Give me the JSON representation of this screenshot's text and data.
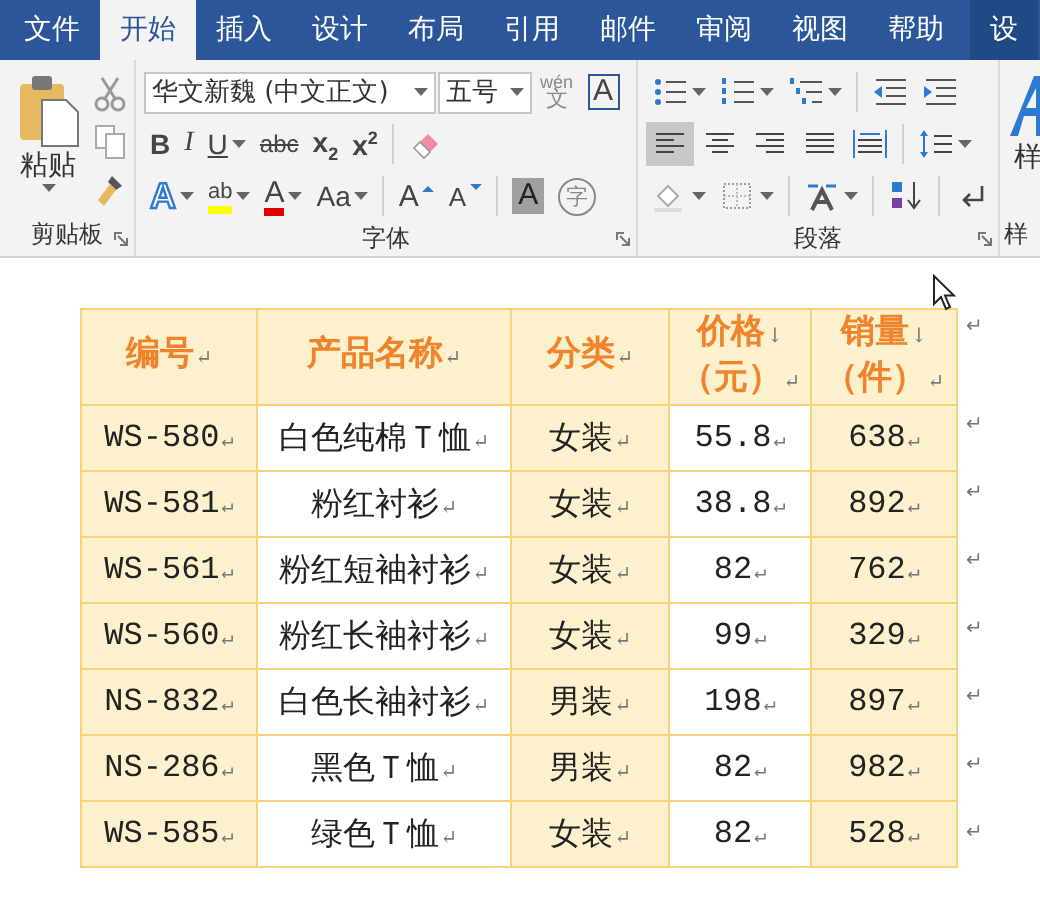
{
  "tabs": [
    {
      "label": "文件",
      "selected": false,
      "contextual": false
    },
    {
      "label": "开始",
      "selected": true,
      "contextual": false
    },
    {
      "label": "插入",
      "selected": false,
      "contextual": false
    },
    {
      "label": "设计",
      "selected": false,
      "contextual": false
    },
    {
      "label": "布局",
      "selected": false,
      "contextual": false
    },
    {
      "label": "引用",
      "selected": false,
      "contextual": false
    },
    {
      "label": "邮件",
      "selected": false,
      "contextual": false
    },
    {
      "label": "审阅",
      "selected": false,
      "contextual": false
    },
    {
      "label": "视图",
      "selected": false,
      "contextual": false
    },
    {
      "label": "帮助",
      "selected": false,
      "contextual": false
    },
    {
      "label": "设",
      "selected": false,
      "contextual": true
    }
  ],
  "clipboard": {
    "paste_label": "粘贴",
    "group_label": "剪贴板"
  },
  "font": {
    "font_name": "华文新魏 (中文正文)",
    "font_size": "五号",
    "group_label": "字体",
    "row1": [
      {
        "kind": "phonetic",
        "label": "wén",
        "label2": "文"
      },
      {
        "kind": "border",
        "label": "A"
      }
    ],
    "row2": [
      {
        "kind": "bold",
        "label": "B"
      },
      {
        "kind": "italic",
        "label": "I"
      },
      {
        "kind": "underline",
        "label": "U",
        "dropdown": true
      },
      {
        "kind": "strike",
        "label": "abc"
      },
      {
        "kind": "sub",
        "label": "x$_{2}$"
      },
      {
        "kind": "sup",
        "label": "x$^{2}$"
      },
      {
        "kind": "eraser"
      }
    ],
    "row3": [
      {
        "kind": "effect",
        "label": "A",
        "dropdown": true
      },
      {
        "kind": "highlight",
        "label": "ab",
        "dropdown": true
      },
      {
        "kind": "color",
        "label": "A",
        "dropdown": true
      },
      {
        "kind": "case",
        "label": "Aa",
        "dropdown": true
      },
      {
        "kind": "grow",
        "label": "A"
      },
      {
        "kind": "shrink",
        "label": "A"
      },
      {
        "kind": "shade",
        "label": "A"
      },
      {
        "kind": "enclose",
        "label": "字"
      }
    ]
  },
  "paragraph": {
    "group_label": "段落",
    "row1": [
      {
        "kind": "bullets",
        "selected": false
      },
      {
        "kind": "numbering",
        "selected": false
      },
      {
        "kind": "multilevel",
        "selected": false
      },
      {
        "kind": "outdent",
        "selected": false
      },
      {
        "kind": "indent",
        "selected": false
      }
    ],
    "row2": [
      {
        "kind": "align-left",
        "selected": true
      },
      {
        "kind": "align-center",
        "selected": false
      },
      {
        "kind": "align-right",
        "selected": false
      },
      {
        "kind": "justify",
        "selected": false
      },
      {
        "kind": "distribute",
        "selected": false
      },
      {
        "kind": "line-spacing",
        "selected": false
      }
    ],
    "row3": [
      {
        "kind": "shading",
        "selected": false
      },
      {
        "kind": "borders",
        "selected": false
      },
      {
        "kind": "asian-layout",
        "selected": false
      },
      {
        "kind": "sort",
        "selected": false
      },
      {
        "kind": "marks",
        "selected": false
      }
    ]
  },
  "styles": {
    "button_label": "样",
    "group_label": "样"
  },
  "table": {
    "header": [
      {
        "lines": [
          {
            "text": "编号",
            "mark": "↵"
          }
        ]
      },
      {
        "lines": [
          {
            "text": "产品名称",
            "mark": "↵"
          }
        ]
      },
      {
        "lines": [
          {
            "text": "分类",
            "mark": "↵"
          }
        ]
      },
      {
        "lines": [
          {
            "text": "价格",
            "mark": "↓"
          },
          {
            "text": "（元）",
            "mark": "↵"
          }
        ]
      },
      {
        "lines": [
          {
            "text": "销量",
            "mark": "↓"
          },
          {
            "text": "（件）",
            "mark": "↵"
          }
        ]
      }
    ],
    "header_end_mark": "↵",
    "rows": [
      {
        "cells": [
          {
            "text": "WS-580",
            "mark": "↵"
          },
          {
            "text": "白色纯棉Ｔ恤",
            "mark": "↵"
          },
          {
            "text": "女装",
            "mark": "↵"
          },
          {
            "text": "55.8",
            "mark": "↵"
          },
          {
            "text": "638",
            "mark": "↵"
          }
        ],
        "end_mark": "↵"
      },
      {
        "cells": [
          {
            "text": "WS-581",
            "mark": "↵"
          },
          {
            "text": "粉红衬衫",
            "mark": "↵"
          },
          {
            "text": "女装",
            "mark": "↵"
          },
          {
            "text": "38.8",
            "mark": "↵"
          },
          {
            "text": "892",
            "mark": "↵"
          }
        ],
        "end_mark": "↵"
      },
      {
        "cells": [
          {
            "text": "WS-561",
            "mark": "↵"
          },
          {
            "text": "粉红短袖衬衫",
            "mark": "↵"
          },
          {
            "text": "女装",
            "mark": "↵"
          },
          {
            "text": "82",
            "mark": "↵"
          },
          {
            "text": "762",
            "mark": "↵"
          }
        ],
        "end_mark": "↵"
      },
      {
        "cells": [
          {
            "text": "WS-560",
            "mark": "↵"
          },
          {
            "text": "粉红长袖衬衫",
            "mark": "↵"
          },
          {
            "text": "女装",
            "mark": "↵"
          },
          {
            "text": "99",
            "mark": "↵"
          },
          {
            "text": "329",
            "mark": "↵"
          }
        ],
        "end_mark": "↵"
      },
      {
        "cells": [
          {
            "text": "NS-832",
            "mark": "↵"
          },
          {
            "text": "白色长袖衬衫",
            "mark": "↵"
          },
          {
            "text": "男装",
            "mark": "↵"
          },
          {
            "text": "198",
            "mark": "↵"
          },
          {
            "text": "897",
            "mark": "↵"
          }
        ],
        "end_mark": "↵"
      },
      {
        "cells": [
          {
            "text": "NS-286",
            "mark": "↵"
          },
          {
            "text": "黑色Ｔ恤",
            "mark": "↵"
          },
          {
            "text": "男装",
            "mark": "↵"
          },
          {
            "text": "82",
            "mark": "↵"
          },
          {
            "text": "982",
            "mark": "↵"
          }
        ],
        "end_mark": "↵"
      },
      {
        "cells": [
          {
            "text": "WS-585",
            "mark": "↵"
          },
          {
            "text": "绿色Ｔ恤",
            "mark": "↵"
          },
          {
            "text": "女装",
            "mark": "↵"
          },
          {
            "text": "82",
            "mark": "↵"
          },
          {
            "text": "528",
            "mark": "↵"
          }
        ],
        "end_mark": "↵"
      }
    ]
  }
}
